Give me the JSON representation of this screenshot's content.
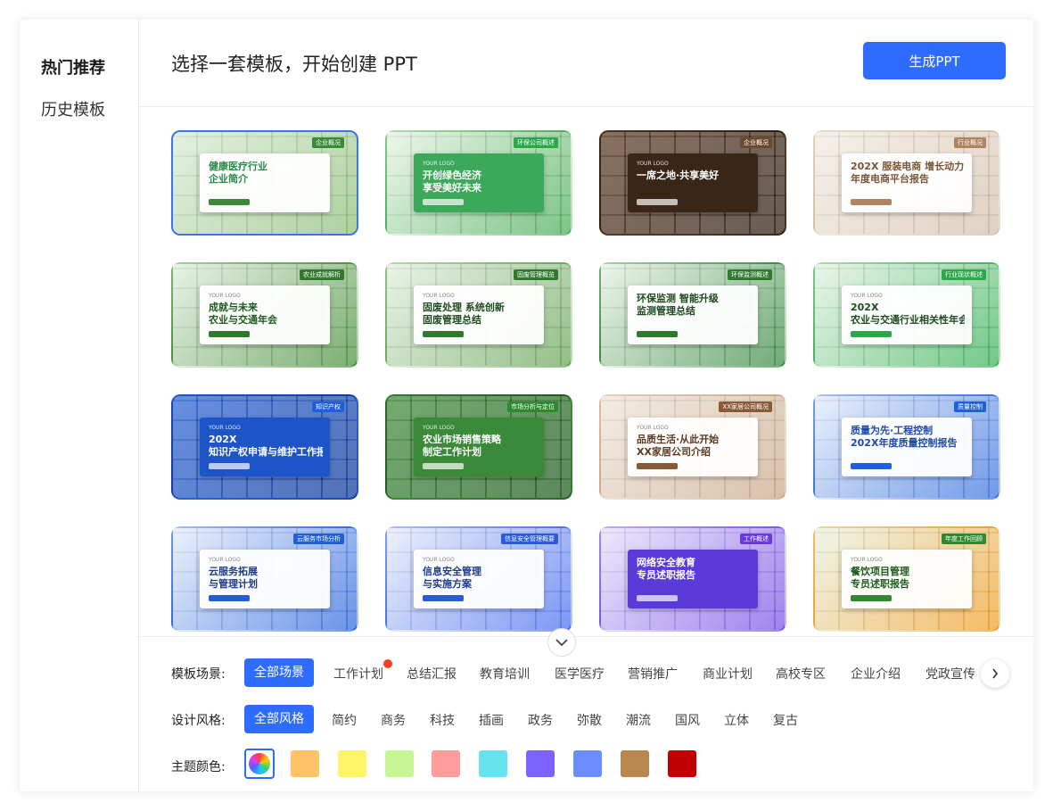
{
  "sidebar": {
    "items": [
      {
        "label": "热门推荐",
        "active": true
      },
      {
        "label": "历史模板",
        "active": false
      }
    ]
  },
  "header": {
    "title": "选择一套模板，开始创建 PPT",
    "generate_label": "生成PPT"
  },
  "templates": [
    {
      "logo": "",
      "line1": "健康医疗行业",
      "line2": "企业简介",
      "tag": "企业概况",
      "accent": "#3a8a3a",
      "title_color": "#2a8a4a",
      "bg1": "#d9ecd6",
      "bg2": "#8fbf7a",
      "selected": true
    },
    {
      "logo": "YOUR LOGO",
      "line1": "开创绿色经济",
      "line2": "享受美好未来",
      "tag": "环保公司概述",
      "accent": "#2aa84a",
      "title_color": "#ffffff",
      "bg1": "#e6f3e2",
      "bg2": "#4cae5a",
      "panel_dark": "#3ca95a"
    },
    {
      "logo": "YOUR LOGO",
      "line1": "一席之地·共享美好",
      "line2": "",
      "tag": "企业概况",
      "accent": "#6b4a2e",
      "title_color": "#ffffff",
      "bg1": "#5a3b24",
      "bg2": "#2e1d12",
      "panel_dark": "#3a2617"
    },
    {
      "logo": "",
      "line1": "202X 服装电商 增长动力",
      "line2": "年度电商平台报告",
      "tag": "行业概况",
      "accent": "#b08462",
      "title_color": "#7a5538",
      "bg1": "#f2ebe3",
      "bg2": "#d4c0aa"
    },
    {
      "logo": "YOUR LOGO",
      "line1": "成就与未来",
      "line2": "农业与交通年会",
      "tag": "农业成就解析",
      "accent": "#2f7a2f",
      "title_color": "#1f5a1f",
      "bg1": "#dfeedd",
      "bg2": "#4a8f3c"
    },
    {
      "logo": "YOUR LOGO",
      "line1": "固废处理 系统创新",
      "line2": "固废管理总结",
      "tag": "固废管理概览",
      "accent": "#2f7a2f",
      "title_color": "#1f4a1f",
      "bg1": "#e3efe0",
      "bg2": "#6aa55a"
    },
    {
      "logo": "",
      "line1": "环保监测 智能升级",
      "line2": "监测管理总结",
      "tag": "环保监测概述",
      "accent": "#2f7a2f",
      "title_color": "#1f4a1f",
      "bg1": "#e6f1e4",
      "bg2": "#3a8a44"
    },
    {
      "logo": "YOUR LOGO",
      "line1": "202X",
      "line2": "农业与交通行业相关性年会",
      "tag": "行业现状概述",
      "accent": "#2aa84a",
      "title_color": "#1f4a1f",
      "bg1": "#e3f2e3",
      "bg2": "#3bb35a"
    },
    {
      "logo": "YOUR LOGO",
      "line1": "202X",
      "line2": "知识产权申请与维护工作报告",
      "tag": "知识产权",
      "accent": "#1f5fd9",
      "title_color": "#ffffff",
      "bg1": "#2b64d8",
      "bg2": "#0f3a9a",
      "panel_dark": "#1d55c8"
    },
    {
      "logo": "YOUR LOGO",
      "line1": "农业市场销售策略",
      "line2": "制定工作计划",
      "tag": "市场分析与定位",
      "accent": "#2f8a2f",
      "title_color": "#ffffff",
      "bg1": "#3e8a3a",
      "bg2": "#1f5a1f",
      "panel_dark": "#3a8a3a"
    },
    {
      "logo": "YOUR LOGO",
      "line1": "品质生活·从此开始",
      "line2": "XX家居公司介绍",
      "tag": "XX家居公司概况",
      "accent": "#8a5a38",
      "title_color": "#5a3a22",
      "bg1": "#efe5da",
      "bg2": "#c9a98a"
    },
    {
      "logo": "",
      "line1": "质量为先·工程控制",
      "line2": "202X年度质量控制报告",
      "tag": "质量控制",
      "accent": "#1f5fd9",
      "title_color": "#1f4aa8",
      "bg1": "#e2ebfa",
      "bg2": "#3a74e0"
    },
    {
      "logo": "YOUR LOGO",
      "line1": "云服务拓展",
      "line2": "与管理计划",
      "tag": "云服务市场分析",
      "accent": "#1f5fd9",
      "title_color": "#1f3a8a",
      "bg1": "#e4ecfb",
      "bg2": "#2f6ae0"
    },
    {
      "logo": "YOUR LOGO",
      "line1": "信息安全管理",
      "line2": "与实施方案",
      "tag": "信息安全管理概要",
      "accent": "#2a5ae0",
      "title_color": "#1f3a8a",
      "bg1": "#e5ebfa",
      "bg2": "#4a6ff0"
    },
    {
      "logo": "",
      "line1": "网络安全教育",
      "line2": "专员述职报告",
      "tag": "工作概述",
      "accent": "#6a3ae0",
      "title_color": "#ffffff",
      "bg1": "#e6e0fa",
      "bg2": "#7a54e8",
      "panel_dark": "#5a3ad8"
    },
    {
      "logo": "YOUR LOGO",
      "line1": "餐饮项目管理",
      "line2": "专员述职报告",
      "tag": "年度工作回顾",
      "accent": "#2f8a2f",
      "title_color": "#1f5a1f",
      "bg1": "#e9f2e3",
      "bg2": "#f0a028"
    }
  ],
  "filters": {
    "scene": {
      "label": "模板场景:",
      "items": [
        "全部场景",
        "工作计划",
        "总结汇报",
        "教育培训",
        "医学医疗",
        "营销推广",
        "商业计划",
        "高校专区",
        "企业介绍",
        "党政宣传"
      ],
      "active": 0,
      "hot_index": 1
    },
    "style": {
      "label": "设计风格:",
      "items": [
        "全部风格",
        "简约",
        "商务",
        "科技",
        "插画",
        "政务",
        "弥散",
        "潮流",
        "国风",
        "立体",
        "复古"
      ],
      "active": 0
    },
    "color": {
      "label": "主题颜色:",
      "swatches": [
        "all",
        "#ffc266",
        "#fff566",
        "#c6f592",
        "#ff9c9c",
        "#66e3ee",
        "#7b63ff",
        "#6b8cff",
        "#b8864f",
        "#c00000"
      ],
      "active": 0
    }
  }
}
